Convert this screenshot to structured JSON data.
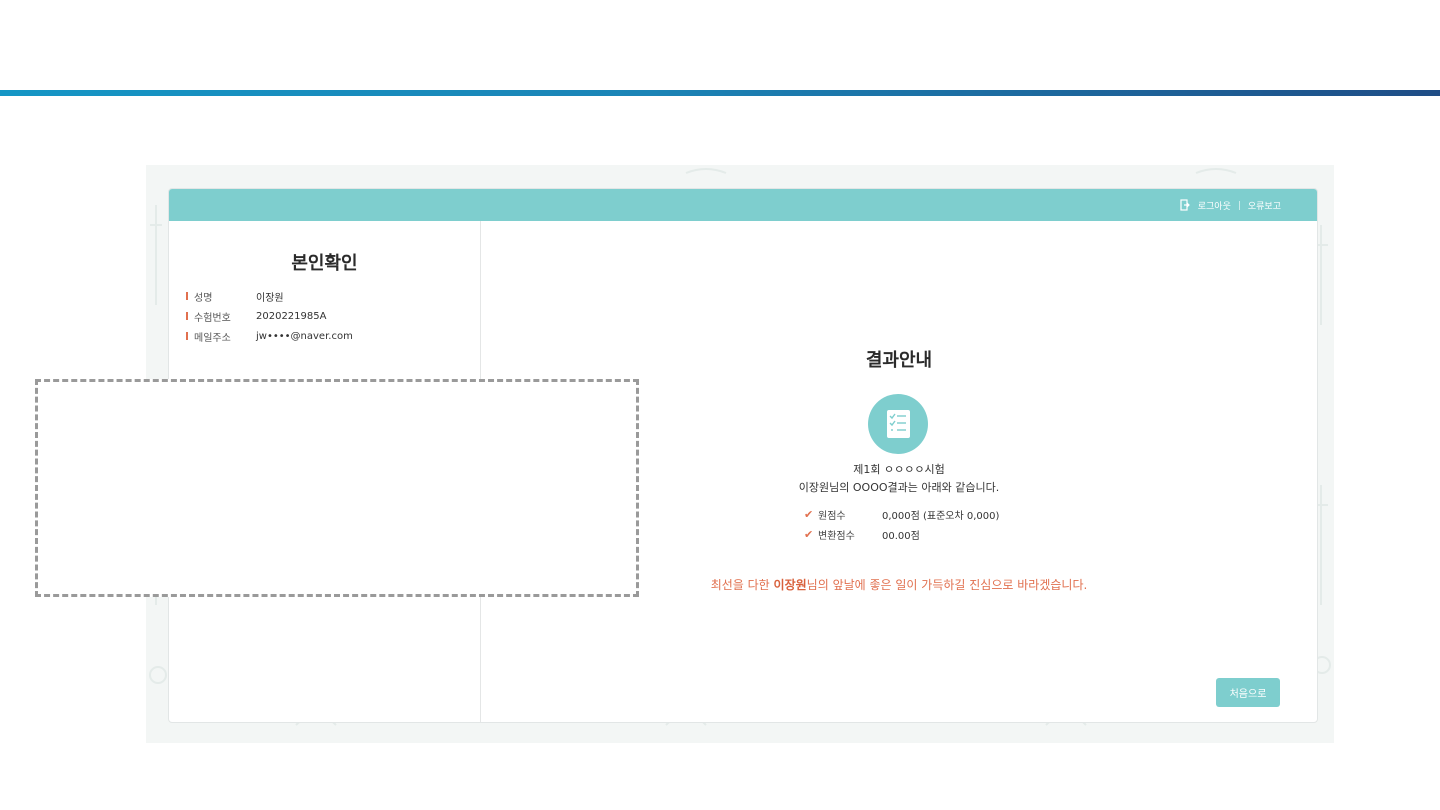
{
  "header": {
    "logout_label": "로그아웃",
    "error_report_label": "오류보고"
  },
  "identity": {
    "title": "본인확인",
    "rows": [
      {
        "label": "성명",
        "value": "이장원"
      },
      {
        "label": "수험번호",
        "value": "2020221985A"
      },
      {
        "label": "메일주소",
        "value": "jw••••@naver.com"
      }
    ]
  },
  "result": {
    "title": "결과안내",
    "icon": "checklist-icon",
    "exam_name": "제1회 ㅇㅇㅇㅇ시험",
    "exam_desc": "이장원님의 OOOO결과는 아래와 같습니다.",
    "scores": [
      {
        "label": "원점수",
        "value": "0,000점 (표준오차 0,000)"
      },
      {
        "label": "변환점수",
        "value": "00.00점"
      }
    ],
    "closing_prefix": "최선을 다한 ",
    "closing_name": "이장원",
    "closing_suffix": "님의 앞날에 좋은 일이 가득하길 진심으로 바라겠습니다.",
    "home_button_label": "처음으로"
  },
  "colors": {
    "accent": "#7ecece",
    "highlight": "#e1704f",
    "top_bar_start": "#1596c5",
    "top_bar_end": "#1f4d86"
  }
}
